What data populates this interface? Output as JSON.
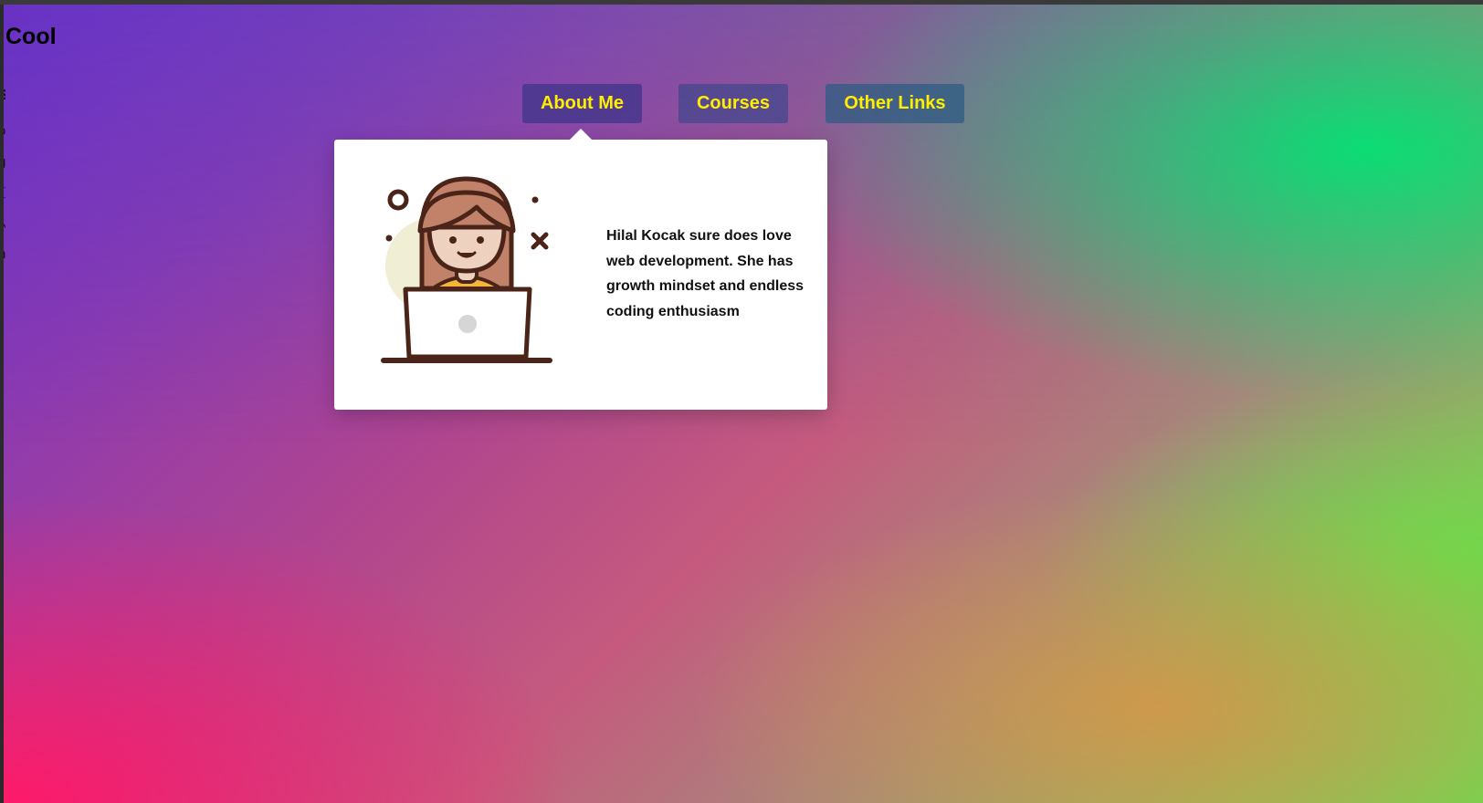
{
  "page": {
    "site_title": "Cool",
    "edge_fragments": [
      "l",
      "s",
      "o",
      "g",
      "T",
      "N",
      "n"
    ]
  },
  "nav": {
    "items": [
      {
        "label": "About Me",
        "active": true
      },
      {
        "label": "Courses",
        "active": false
      },
      {
        "label": "Other Links",
        "active": false
      }
    ],
    "label_color": "#ffee00"
  },
  "popover": {
    "text": "Hilal Kocak sure does love web development. She has growth mindset and endless coding enthusiasm",
    "illustration": "woman-at-laptop-illustration"
  }
}
